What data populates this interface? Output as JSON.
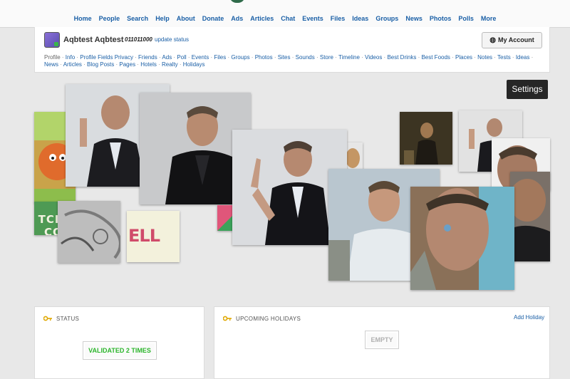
{
  "topnav": {
    "items": [
      "Home",
      "People",
      "Search",
      "Help",
      "About",
      "Donate",
      "Ads",
      "Articles",
      "Chat",
      "Events",
      "Files",
      "Ideas",
      "Groups",
      "News",
      "Photos",
      "Polls",
      "More"
    ]
  },
  "profile": {
    "name": "Aqbtest Aqbtest",
    "status_number": "011011000",
    "update_status": "update status",
    "my_account": "My Account",
    "subnav": {
      "first": "Profile",
      "links": [
        "Info",
        "Profile Fields Privacy",
        "Friends",
        "Ads",
        "Poll",
        "Events",
        "Files",
        "Groups",
        "Photos",
        "Sites",
        "Sounds",
        "Store",
        "Timeline",
        "Videos",
        "Best Drinks",
        "Best Foods",
        "Places",
        "Notes",
        "Tests",
        "Ideas",
        "News",
        "Articles",
        "Blog Posts",
        "Pages",
        "Hotels",
        "Realty",
        "Holidays"
      ]
    }
  },
  "settings_label": "Settings",
  "collage": {
    "text_tile_1": "TCH BE COOL",
    "text_tile_2": "ELL"
  },
  "status_card": {
    "title": "STATUS",
    "validated": "VALIDATED 2 TIMES"
  },
  "holidays_card": {
    "title": "UPCOMING HOLIDAYS",
    "add_link": "Add Holiday",
    "empty": "EMPTY"
  },
  "colors": {
    "link": "#1a5fa6",
    "validated": "#2bb52b",
    "settings_bg": "#262626"
  }
}
